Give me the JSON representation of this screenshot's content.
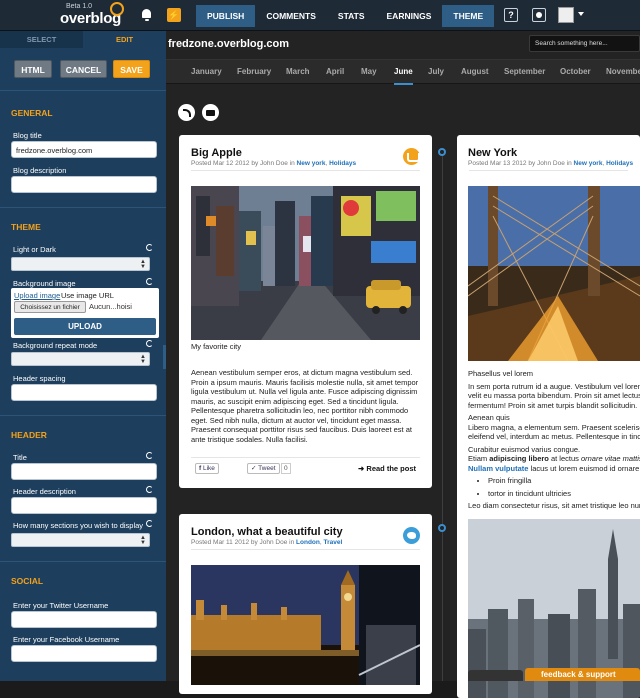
{
  "topbar": {
    "beta": "Beta 1.0",
    "brand": "overblog",
    "nav": [
      "PUBLISH",
      "COMMENTS",
      "STATS",
      "EARNINGS",
      "THEME"
    ],
    "help": "?"
  },
  "sidebar": {
    "tabs": {
      "select": "SELECT",
      "edit": "EDIT"
    },
    "buttons": {
      "html": "HTML",
      "cancel": "CANCEL",
      "save": "SAVE"
    },
    "general": {
      "title": "GENERAL",
      "blog_title_label": "Blog title",
      "blog_title_value": "fredzone.overblog.com",
      "blog_description_label": "Blog description",
      "blog_description_value": ""
    },
    "theme": {
      "title": "THEME",
      "light_dark_label": "Light or Dark",
      "background_image_label": "Background image",
      "upload_link": "Upload image",
      "use_url": "Use image URL",
      "choose_file": "Choisissez un fichier",
      "file_none": "Aucun...hoisi",
      "upload_button": "UPLOAD",
      "repeat_label": "Background repeat mode",
      "header_spacing_label": "Header spacing"
    },
    "header": {
      "title": "HEADER",
      "title_label": "Title",
      "description_label": "Header description",
      "sections_label": "How many sections you wish to display"
    },
    "social": {
      "title": "SOCIAL",
      "twitter_label": "Enter your Twitter Username",
      "facebook_label": "Enter your Facebook Username"
    }
  },
  "main": {
    "blog_title": "fredzone.overblog.com",
    "search_placeholder": "Search something here...",
    "months": [
      "January",
      "February",
      "March",
      "April",
      "May",
      "June",
      "July",
      "August",
      "September",
      "October",
      "November"
    ],
    "active_month": "June"
  },
  "posts": {
    "p1": {
      "title": "Big Apple",
      "meta_prefix": "Posted Mar 12 2012 by John Doe in",
      "tag1": "New york",
      "tag2": "Holidays",
      "sep": ",",
      "caption": "My favorite city",
      "body": "Aenean vestibulum semper eros, at dictum magna vestibulum sed. Proin a ipsum mauris. Mauris facilisis molestie nulla, sit amet tempor ligula vestibulum ut. Nulla vel ligula ante. Fusce adipiscing dignissim mauris, ac suscipit enim adipiscing eget. Sed a tincidunt ligula. Pellentesque pharetra sollicitudin leo, nec porttitor nibh commodo eget. Sed nibh nulla, dictum at auctor vel, tincidunt eget massa. Praesent consequat porttitor risus sed faucibus. Duis laoreet est at ante tristique sodales. Nulla facilisi.",
      "like": "Like",
      "tweet": "Tweet",
      "tweet_count": "0",
      "read_more": "Read the post"
    },
    "p2": {
      "title": "London, what a beautiful city",
      "meta_prefix": "Posted Mar 11 2012 by John Doe in",
      "tag1": "London",
      "tag2": "Travel",
      "sep": ","
    },
    "p3": {
      "title": "New York",
      "meta_prefix": "Posted Mar 13 2012 by John Doe in",
      "tag1": "New york",
      "tag2": "Holidays",
      "sep": ",",
      "l1": "Phasellus vel lorem",
      "l2": "In sem porta rutrum id a augue. Vestibulum vel lorem",
      "l3": "velit eu massa porta bibendum. Proin sit amet lectus",
      "l4": "fermentum! Proin sit amet turpis blandit sollicitudin.",
      "l5": "Aenean quis",
      "l6": "Libero magna, a elementum sem. Praesent scelerisque",
      "l7": "eleifend vel, interdum ac metus. Pellentesque in tincidunt",
      "l8": "Curabitur euismod varius congue.",
      "l9a": "Etiam ",
      "l9b": "adipiscing libero",
      "l9c": " at lectus ",
      "l9d": "ornare vitae mattis",
      "l10a": "Nullam vulputate",
      "l10b": " lacus ut lorem euismod id ornare",
      "li1": "Proin fringilla",
      "li2": "tortor in tincidunt ultricies",
      "l11": "Leo diam consectetur risus, sit amet tristique leo nunc"
    }
  },
  "footer": {
    "feedback": "feedback & support"
  }
}
